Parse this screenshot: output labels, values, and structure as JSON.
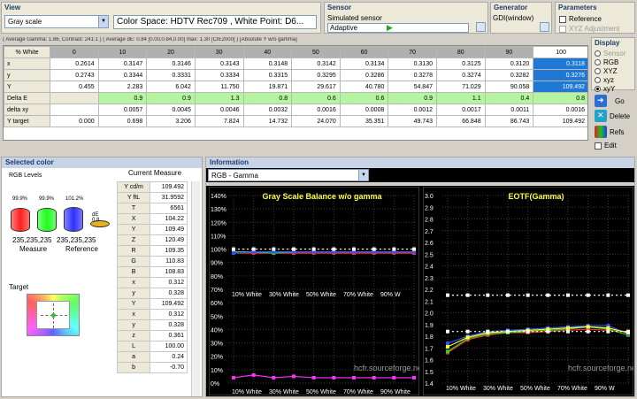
{
  "view": {
    "title": "View",
    "mode": "Gray scale",
    "colorspace": "Color Space: HDTV Rec709 , White Point: D6..."
  },
  "sensor": {
    "title": "Sensor",
    "name": "Simulated sensor",
    "mode": "Adaptive"
  },
  "generator": {
    "title": "Generator",
    "name": "GDI(window)"
  },
  "parameters": {
    "title": "Parameters",
    "reference": "Reference",
    "xyz_adjust": "XYZ Adjustment"
  },
  "display": {
    "title": "Display",
    "options": [
      "Sensor",
      "RGB",
      "XYZ",
      "xyz",
      "xyY"
    ],
    "selected": 4
  },
  "buttons": {
    "go": "Go",
    "delete": "Delete",
    "refs": "Refs",
    "edit": "Edit"
  },
  "summary": "( Average Gamma: 1.86, Contrast: 241:1 )  ( Average dE: 0.84 [0.00,0.84,0.00] max: 1.30 [CIE2000] )  [Absolute Y w/o gamma]",
  "table": {
    "corner": "% White",
    "columns": [
      "0",
      "10",
      "20",
      "30",
      "40",
      "50",
      "60",
      "70",
      "80",
      "90",
      "100"
    ],
    "rows": [
      {
        "label": "x",
        "values": [
          "0.2614",
          "0.3147",
          "0.3146",
          "0.3143",
          "0.3148",
          "0.3142",
          "0.3134",
          "0.3130",
          "0.3125",
          "0.3120",
          "0.3118"
        ]
      },
      {
        "label": "y",
        "values": [
          "0.2743",
          "0.3344",
          "0.3331",
          "0.3334",
          "0.3315",
          "0.3295",
          "0.3286",
          "0.3278",
          "0.3274",
          "0.3282",
          "0.3276"
        ]
      },
      {
        "label": "Y",
        "values": [
          "0.455",
          "2.283",
          "6.042",
          "11.750",
          "19.871",
          "29.617",
          "40.780",
          "54.847",
          "71.029",
          "90.058",
          "109.492"
        ]
      },
      {
        "label": "Delta E",
        "values": [
          "",
          "0.9",
          "0.9",
          "1.3",
          "0.8",
          "0.6",
          "0.6",
          "0.9",
          "1.1",
          "0.4",
          "0.8"
        ]
      },
      {
        "label": "delta xy",
        "values": [
          "",
          "0.0057",
          "0.0045",
          "0.0046",
          "0.0032",
          "0.0016",
          "0.0008",
          "0.0012",
          "0.0017",
          "0.0011",
          "0.0016"
        ]
      },
      {
        "label": "Y target",
        "values": [
          "0.000",
          "0.698",
          "3.206",
          "7.824",
          "14.732",
          "24.070",
          "35.351",
          "49.743",
          "66.848",
          "86.743",
          "109.492"
        ]
      }
    ]
  },
  "selected_color": {
    "title": "Selected color",
    "rgb_levels": "RGB Levels",
    "bars": [
      {
        "pct": "99.9%",
        "value": 99.9,
        "color": "#ff2020"
      },
      {
        "pct": "99.9%",
        "value": 99.9,
        "color": "#20ff20"
      },
      {
        "pct": "101.2%",
        "value": 101.2,
        "color": "#3030ff"
      }
    ],
    "de_label": "dE 0.8",
    "measure_rgb": "235,235,235",
    "reference_rgb": "235,235,235",
    "measure_label": "Measure",
    "reference_label": "Reference",
    "target_label": "Target"
  },
  "current_measure": {
    "title": "Current Measure",
    "rows": [
      {
        "k": "Y cd/m",
        "v": "109.492"
      },
      {
        "k": "Y ftL",
        "v": "31.9592"
      },
      {
        "k": "T",
        "v": "6561"
      },
      {
        "k": "X",
        "v": "104.22"
      },
      {
        "k": "Y",
        "v": "109.49"
      },
      {
        "k": "Z",
        "v": "120.49"
      },
      {
        "k": "R",
        "v": "109.35"
      },
      {
        "k": "G",
        "v": "110.83"
      },
      {
        "k": "B",
        "v": "108.83"
      },
      {
        "k": "x",
        "v": "0.312"
      },
      {
        "k": "y",
        "v": "0.328"
      },
      {
        "k": "Y",
        "v": "109.492"
      },
      {
        "k": "x",
        "v": "0.312"
      },
      {
        "k": "y",
        "v": "0.328"
      },
      {
        "k": "z",
        "v": "0.361"
      },
      {
        "k": "L",
        "v": "100.00"
      },
      {
        "k": "a",
        "v": "0.24"
      },
      {
        "k": "b",
        "v": "-0.70"
      }
    ]
  },
  "information": {
    "title": "Information",
    "mode": "RGB - Gamma",
    "watermark": "hcfr.sourceforge.net"
  },
  "chart_data": [
    {
      "type": "line",
      "title": "Gray Scale Balance w/o gamma",
      "yticks": [
        "140%",
        "130%",
        "120%",
        "110%",
        "100%",
        "90%",
        "80%",
        "70%",
        "60%",
        "50%",
        "40%",
        "30%",
        "20%",
        "10%",
        "0%"
      ],
      "xticks": [
        "10% White",
        "30% White",
        "50% White",
        "70% White",
        "90% W"
      ],
      "xticks_bottom": [
        "10% White",
        "30% White",
        "50% White",
        "70% White",
        "90% White"
      ],
      "x": [
        10,
        20,
        30,
        40,
        50,
        60,
        70,
        80,
        90,
        100
      ],
      "ylim": [
        0,
        140
      ],
      "series": [
        {
          "color": "#ff3030",
          "values": [
            97,
            97,
            97,
            97,
            97,
            97,
            97,
            97,
            97,
            97
          ]
        },
        {
          "color": "#30d030",
          "values": [
            98,
            98,
            97,
            98,
            98,
            98,
            98,
            98,
            98,
            98
          ]
        },
        {
          "color": "#3050ff",
          "values": [
            97,
            98,
            98,
            98,
            98,
            98,
            98,
            98,
            98,
            98
          ]
        },
        {
          "color": "#ffffff",
          "values": [
            100,
            100,
            100,
            100,
            100,
            100,
            100,
            100,
            100,
            100
          ]
        },
        {
          "color": "#ff30ff",
          "values": [
            4,
            6,
            4,
            5,
            4,
            4,
            4,
            4,
            4,
            4
          ]
        }
      ]
    },
    {
      "type": "line",
      "title": "EOTF(Gamma)",
      "yticks": [
        "3.0",
        "2.9",
        "2.8",
        "2.7",
        "2.6",
        "2.5",
        "2.4",
        "2.3",
        "2.2",
        "2.1",
        "2.0",
        "1.9",
        "1.8",
        "1.7",
        "1.6",
        "1.5",
        "1.4"
      ],
      "xticks": [
        "10% White",
        "30% White",
        "50% White",
        "70% White",
        "90% W"
      ],
      "x": [
        10,
        20,
        30,
        40,
        50,
        60,
        70,
        80,
        90,
        100
      ],
      "ylim": [
        1.4,
        3.0
      ],
      "series": [
        {
          "color": "#ff3030",
          "values": [
            1.66,
            1.77,
            1.81,
            1.83,
            1.83,
            1.84,
            1.85,
            1.86,
            1.85,
            1.84
          ]
        },
        {
          "color": "#30d030",
          "values": [
            1.67,
            1.78,
            1.82,
            1.83,
            1.84,
            1.85,
            1.86,
            1.88,
            1.86,
            1.81
          ]
        },
        {
          "color": "#3050ff",
          "values": [
            1.74,
            1.8,
            1.84,
            1.85,
            1.86,
            1.87,
            1.88,
            1.89,
            1.89,
            1.82
          ]
        },
        {
          "color": "#ffff30",
          "values": [
            1.71,
            1.79,
            1.83,
            1.84,
            1.85,
            1.86,
            1.87,
            1.88,
            1.87,
            1.83
          ]
        },
        {
          "color": "#ffffff",
          "values": [
            2.15,
            2.15,
            2.15,
            2.15,
            2.15,
            2.15,
            2.15,
            2.15,
            2.15,
            2.15
          ]
        },
        {
          "color": "#ffffff",
          "values": [
            1.84,
            1.84,
            1.84,
            1.84,
            1.84,
            1.84,
            1.84,
            1.84,
            1.84,
            1.84
          ]
        }
      ]
    }
  ]
}
